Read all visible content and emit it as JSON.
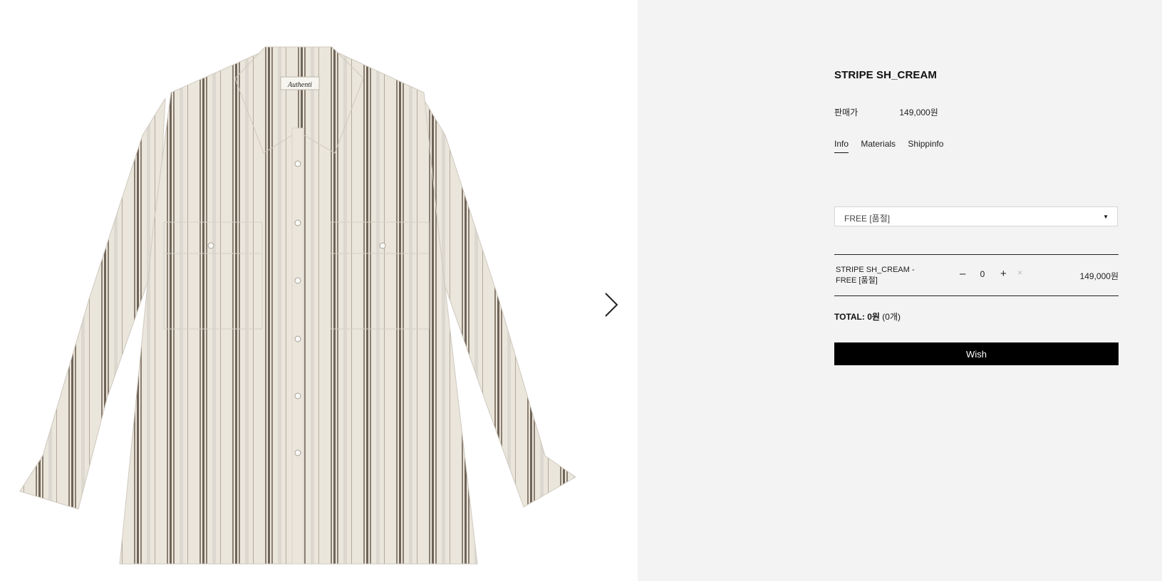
{
  "product": {
    "title": "STRIPE SH_CREAM",
    "price_label": "판매가",
    "price": "149,000원"
  },
  "tabs": [
    {
      "label": "Info",
      "active": true
    },
    {
      "label": "Materials",
      "active": false
    },
    {
      "label": "Shippinfo",
      "active": false
    }
  ],
  "option_select": {
    "value": "FREE [품절]",
    "caret_icon": "caret-down-icon"
  },
  "selected_item": {
    "name": "STRIPE SH_CREAM - FREE [품절]",
    "minus_label": "–",
    "quantity": "0",
    "plus_label": "+",
    "remove_label": "×",
    "price": "149,000원"
  },
  "total": {
    "label": "TOTAL:",
    "amount": "0원",
    "count": "(0개)"
  },
  "wish_button": {
    "label": "Wish"
  },
  "image": {
    "collar_tag_text": "Authenti",
    "stripe_color": "#7d7163",
    "fabric_color": "#ebe6dc"
  },
  "gallery": {
    "next_icon": "chevron-right-icon"
  }
}
